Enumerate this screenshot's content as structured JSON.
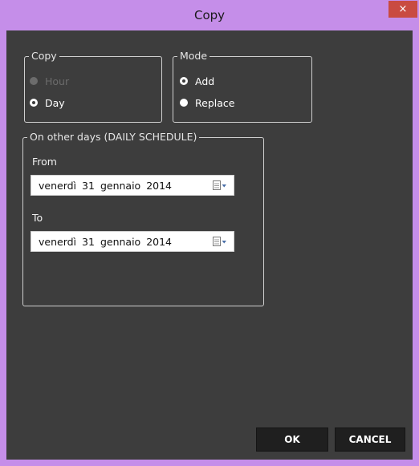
{
  "window": {
    "title": "Copy",
    "close_glyph": "×"
  },
  "copy_group": {
    "legend": "Copy",
    "options": [
      {
        "label": "Hour",
        "state": "disabled"
      },
      {
        "label": "Day",
        "state": "selected"
      }
    ]
  },
  "mode_group": {
    "legend": "Mode",
    "options": [
      {
        "label": "Add",
        "state": "selected"
      },
      {
        "label": "Replace",
        "state": "unselected"
      }
    ]
  },
  "days_group": {
    "legend": "On other days (DAILY SCHEDULE)",
    "from": {
      "label": "From",
      "date": {
        "weekday": "venerdì",
        "day": "31",
        "month": "gennaio",
        "year": "2014"
      },
      "picker_icon": "calendar-dropdown-icon"
    },
    "to": {
      "label": "To",
      "date": {
        "weekday": "venerdì",
        "day": "31",
        "month": "gennaio",
        "year": "2014"
      },
      "picker_icon": "calendar-dropdown-icon"
    }
  },
  "buttons": {
    "ok": "OK",
    "cancel": "CANCEL"
  },
  "colors": {
    "titlebar": "#c58ee9",
    "close_button": "#c94b41",
    "client_background": "#3d3d3d",
    "button_background": "#1f1f1f"
  }
}
